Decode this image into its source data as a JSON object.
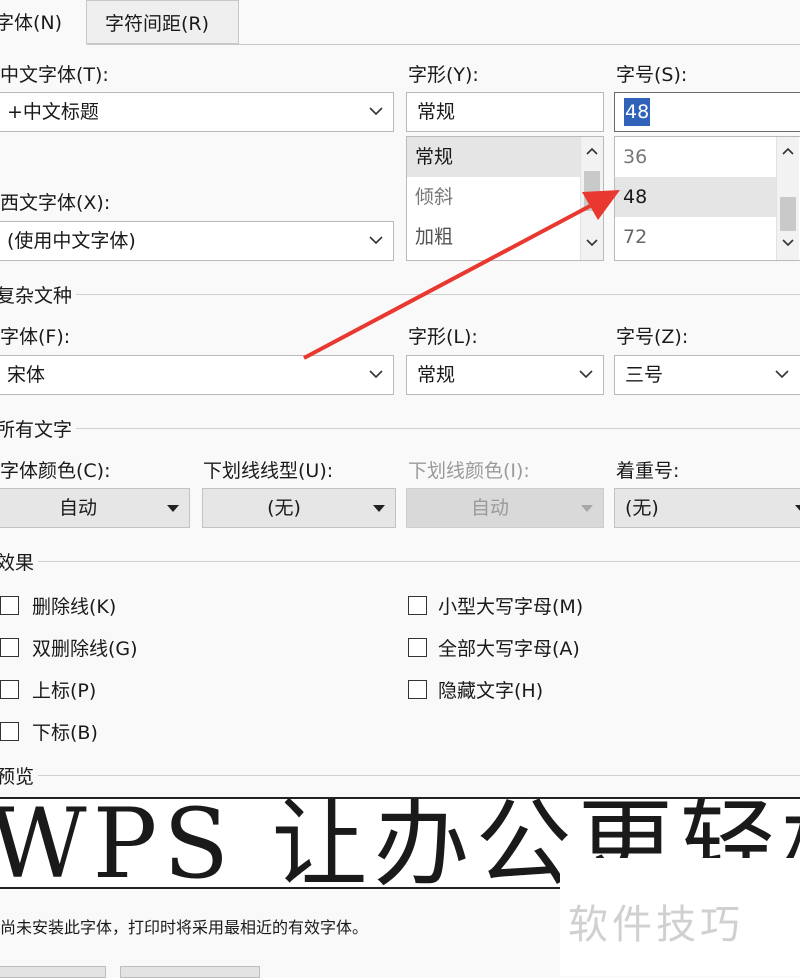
{
  "tabs": [
    {
      "label": "字体(N)"
    },
    {
      "label": "字符间距(R)"
    }
  ],
  "chinese_font": {
    "label": "中文字体(T):",
    "value": "+中文标题"
  },
  "western_font": {
    "label": "西文字体(X):",
    "value": "(使用中文字体)"
  },
  "style": {
    "label": "字形(Y):",
    "value": "常规",
    "options": [
      "常规",
      "倾斜",
      "加粗"
    ],
    "selected": "常规"
  },
  "size": {
    "label": "字号(S):",
    "value": "48",
    "options": [
      "36",
      "48",
      "72"
    ],
    "selected": "48"
  },
  "complex": {
    "header": "复杂文种",
    "font_label": "字体(F):",
    "font_value": "宋体",
    "style_label": "字形(L):",
    "style_value": "常规",
    "size_label": "字号(Z):",
    "size_value": "三号"
  },
  "all_text": {
    "header": "所有文字",
    "color_label": "字体颜色(C):",
    "color_value": "自动",
    "underline_label": "下划线线型(U):",
    "underline_value": "(无)",
    "underline_color_label": "下划线颜色(I):",
    "underline_color_value": "自动",
    "emphasis_label": "着重号:",
    "emphasis_value": "(无)"
  },
  "effects": {
    "header": "效果",
    "left": [
      {
        "label": "删除线(K)"
      },
      {
        "label": "双删除线(G)"
      },
      {
        "label": "上标(P)"
      },
      {
        "label": "下标(B)"
      }
    ],
    "right": [
      {
        "label": "小型大写字母(M)"
      },
      {
        "label": "全部大写字母(A)"
      },
      {
        "label": "隐藏文字(H)"
      }
    ]
  },
  "preview": {
    "header": "预览",
    "sample": "WPS 让办公更轻松",
    "note": "尚未安装此字体，打印时将采用最相近的有效字体。"
  },
  "watermark": "软件技巧",
  "colors": {
    "annotation_arrow": "#e8382f",
    "selection": "#e5e5e5"
  }
}
